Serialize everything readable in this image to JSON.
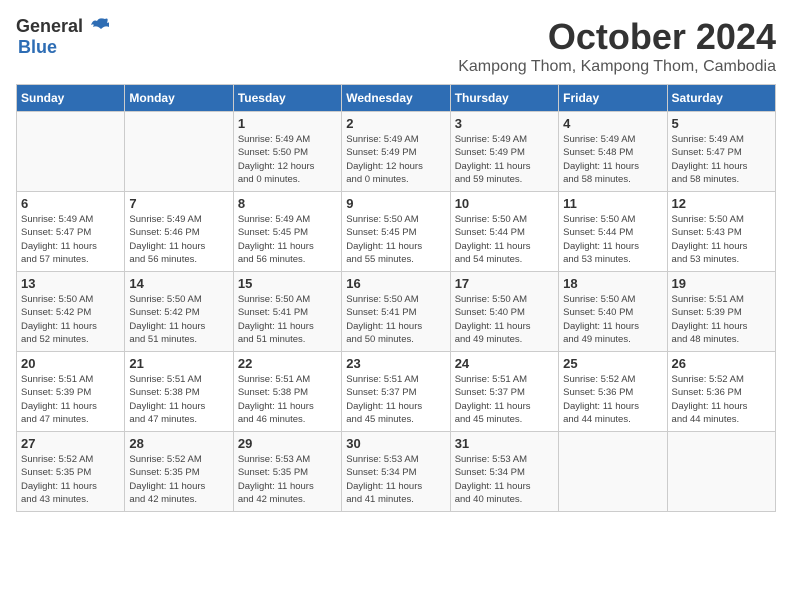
{
  "header": {
    "logo_general": "General",
    "logo_blue": "Blue",
    "month": "October 2024",
    "location": "Kampong Thom, Kampong Thom, Cambodia"
  },
  "weekdays": [
    "Sunday",
    "Monday",
    "Tuesday",
    "Wednesday",
    "Thursday",
    "Friday",
    "Saturday"
  ],
  "weeks": [
    [
      {
        "day": "",
        "info": ""
      },
      {
        "day": "",
        "info": ""
      },
      {
        "day": "1",
        "info": "Sunrise: 5:49 AM\nSunset: 5:50 PM\nDaylight: 12 hours\nand 0 minutes."
      },
      {
        "day": "2",
        "info": "Sunrise: 5:49 AM\nSunset: 5:49 PM\nDaylight: 12 hours\nand 0 minutes."
      },
      {
        "day": "3",
        "info": "Sunrise: 5:49 AM\nSunset: 5:49 PM\nDaylight: 11 hours\nand 59 minutes."
      },
      {
        "day": "4",
        "info": "Sunrise: 5:49 AM\nSunset: 5:48 PM\nDaylight: 11 hours\nand 58 minutes."
      },
      {
        "day": "5",
        "info": "Sunrise: 5:49 AM\nSunset: 5:47 PM\nDaylight: 11 hours\nand 58 minutes."
      }
    ],
    [
      {
        "day": "6",
        "info": "Sunrise: 5:49 AM\nSunset: 5:47 PM\nDaylight: 11 hours\nand 57 minutes."
      },
      {
        "day": "7",
        "info": "Sunrise: 5:49 AM\nSunset: 5:46 PM\nDaylight: 11 hours\nand 56 minutes."
      },
      {
        "day": "8",
        "info": "Sunrise: 5:49 AM\nSunset: 5:45 PM\nDaylight: 11 hours\nand 56 minutes."
      },
      {
        "day": "9",
        "info": "Sunrise: 5:50 AM\nSunset: 5:45 PM\nDaylight: 11 hours\nand 55 minutes."
      },
      {
        "day": "10",
        "info": "Sunrise: 5:50 AM\nSunset: 5:44 PM\nDaylight: 11 hours\nand 54 minutes."
      },
      {
        "day": "11",
        "info": "Sunrise: 5:50 AM\nSunset: 5:44 PM\nDaylight: 11 hours\nand 53 minutes."
      },
      {
        "day": "12",
        "info": "Sunrise: 5:50 AM\nSunset: 5:43 PM\nDaylight: 11 hours\nand 53 minutes."
      }
    ],
    [
      {
        "day": "13",
        "info": "Sunrise: 5:50 AM\nSunset: 5:42 PM\nDaylight: 11 hours\nand 52 minutes."
      },
      {
        "day": "14",
        "info": "Sunrise: 5:50 AM\nSunset: 5:42 PM\nDaylight: 11 hours\nand 51 minutes."
      },
      {
        "day": "15",
        "info": "Sunrise: 5:50 AM\nSunset: 5:41 PM\nDaylight: 11 hours\nand 51 minutes."
      },
      {
        "day": "16",
        "info": "Sunrise: 5:50 AM\nSunset: 5:41 PM\nDaylight: 11 hours\nand 50 minutes."
      },
      {
        "day": "17",
        "info": "Sunrise: 5:50 AM\nSunset: 5:40 PM\nDaylight: 11 hours\nand 49 minutes."
      },
      {
        "day": "18",
        "info": "Sunrise: 5:50 AM\nSunset: 5:40 PM\nDaylight: 11 hours\nand 49 minutes."
      },
      {
        "day": "19",
        "info": "Sunrise: 5:51 AM\nSunset: 5:39 PM\nDaylight: 11 hours\nand 48 minutes."
      }
    ],
    [
      {
        "day": "20",
        "info": "Sunrise: 5:51 AM\nSunset: 5:39 PM\nDaylight: 11 hours\nand 47 minutes."
      },
      {
        "day": "21",
        "info": "Sunrise: 5:51 AM\nSunset: 5:38 PM\nDaylight: 11 hours\nand 47 minutes."
      },
      {
        "day": "22",
        "info": "Sunrise: 5:51 AM\nSunset: 5:38 PM\nDaylight: 11 hours\nand 46 minutes."
      },
      {
        "day": "23",
        "info": "Sunrise: 5:51 AM\nSunset: 5:37 PM\nDaylight: 11 hours\nand 45 minutes."
      },
      {
        "day": "24",
        "info": "Sunrise: 5:51 AM\nSunset: 5:37 PM\nDaylight: 11 hours\nand 45 minutes."
      },
      {
        "day": "25",
        "info": "Sunrise: 5:52 AM\nSunset: 5:36 PM\nDaylight: 11 hours\nand 44 minutes."
      },
      {
        "day": "26",
        "info": "Sunrise: 5:52 AM\nSunset: 5:36 PM\nDaylight: 11 hours\nand 44 minutes."
      }
    ],
    [
      {
        "day": "27",
        "info": "Sunrise: 5:52 AM\nSunset: 5:35 PM\nDaylight: 11 hours\nand 43 minutes."
      },
      {
        "day": "28",
        "info": "Sunrise: 5:52 AM\nSunset: 5:35 PM\nDaylight: 11 hours\nand 42 minutes."
      },
      {
        "day": "29",
        "info": "Sunrise: 5:53 AM\nSunset: 5:35 PM\nDaylight: 11 hours\nand 42 minutes."
      },
      {
        "day": "30",
        "info": "Sunrise: 5:53 AM\nSunset: 5:34 PM\nDaylight: 11 hours\nand 41 minutes."
      },
      {
        "day": "31",
        "info": "Sunrise: 5:53 AM\nSunset: 5:34 PM\nDaylight: 11 hours\nand 40 minutes."
      },
      {
        "day": "",
        "info": ""
      },
      {
        "day": "",
        "info": ""
      }
    ]
  ]
}
